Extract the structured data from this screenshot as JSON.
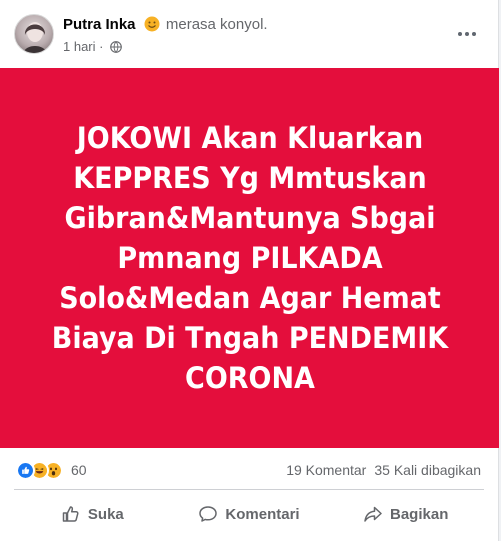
{
  "post": {
    "author": "Putra Inka",
    "feeling_icon": "smiling-face-emoji",
    "feeling_text": "merasa konyol.",
    "timestamp": "1 hari",
    "timestamp_separator": "·",
    "audience_icon": "globe-icon",
    "background_color": "#e40e3c",
    "text_lines": [
      "JOKOWI Akan Kluarkan",
      "KEPPRES Yg Mmtuskan",
      "Gibran&Mantunya Sbgai",
      "Pmnang PILKADA",
      "Solo&Medan Agar Hemat",
      "Biaya Di Tngah PENDEMIK",
      "CORONA"
    ]
  },
  "engagement": {
    "reactions": [
      "like-icon",
      "haha-icon",
      "wow-icon"
    ],
    "reaction_count": "60",
    "comments": "19 Komentar",
    "shares": "35 Kali dibagikan"
  },
  "actions": {
    "like": "Suka",
    "comment": "Komentari",
    "share": "Bagikan"
  },
  "colors": {
    "like_blue": "#1877f2",
    "emoji_yellow": "#f7b125",
    "muted_text": "#65676b"
  }
}
